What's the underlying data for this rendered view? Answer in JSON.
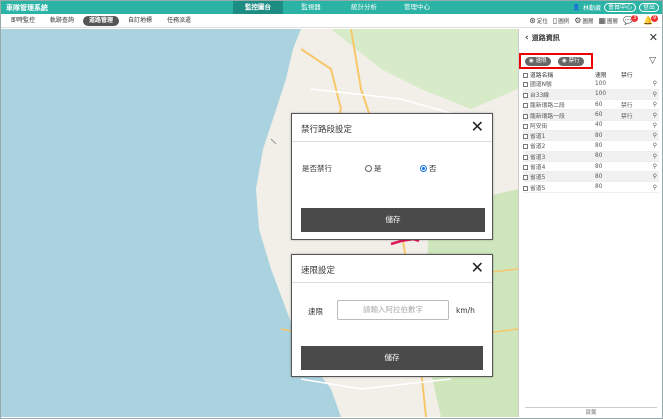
{
  "header": {
    "app_title": "車隊管理系統",
    "nav": [
      "監控圖台",
      "監視器",
      "統計分析",
      "管理中心"
    ],
    "user_name": "林勤崴",
    "member_center": "會員中心",
    "logout": "登出"
  },
  "subnav": {
    "tabs": [
      "即時監控",
      "軌跡查詢",
      "道路管理",
      "自訂地標",
      "任務派遣"
    ],
    "active_tab": "道路管理",
    "tools": [
      {
        "icon": "location-icon",
        "label": "定位"
      },
      {
        "icon": "building-icon",
        "label": "圖例"
      },
      {
        "icon": "gear-icon",
        "label": "圖層"
      },
      {
        "icon": "map-icon",
        "label": "圖層"
      }
    ],
    "badge_count_1": "3",
    "badge_count_2": "9"
  },
  "sidebar": {
    "title": "道路資訊",
    "chip_speed": "速限",
    "chip_ban": "禁行",
    "col_name": "道路名稱",
    "col_speed": "速限",
    "col_ban": "禁行",
    "rows": [
      {
        "name": "國道N號",
        "speed": "100",
        "ban": ""
      },
      {
        "name": "台33線",
        "speed": "100",
        "ban": ""
      },
      {
        "name": "龍新環路二段",
        "speed": "60",
        "ban": "禁行"
      },
      {
        "name": "龍新環路一段",
        "speed": "60",
        "ban": "禁行"
      },
      {
        "name": "阿安街",
        "speed": "40",
        "ban": ""
      },
      {
        "name": "省道1",
        "speed": "80",
        "ban": ""
      },
      {
        "name": "省道2",
        "speed": "80",
        "ban": ""
      },
      {
        "name": "省道3",
        "speed": "80",
        "ban": ""
      },
      {
        "name": "省道4",
        "speed": "80",
        "ban": ""
      },
      {
        "name": "省道5",
        "speed": "80",
        "ban": ""
      },
      {
        "name": "省道5",
        "speed": "80",
        "ban": ""
      }
    ],
    "footer": "頁籤"
  },
  "ban_dialog": {
    "title": "禁行路段設定",
    "field_label": "是否禁行",
    "option_yes": "是",
    "option_no": "否",
    "selected": "否",
    "save": "儲存"
  },
  "speed_dialog": {
    "title": "速限設定",
    "field_label": "速限",
    "placeholder": "請輸入阿拉伯數字",
    "unit": "km/h",
    "save": "儲存"
  },
  "colors": {
    "accent": "#2bb3a6",
    "accent_dark": "#1d8c83",
    "water": "#aad3df",
    "highlight": "#e00000",
    "road_ban": "#e0185a"
  }
}
